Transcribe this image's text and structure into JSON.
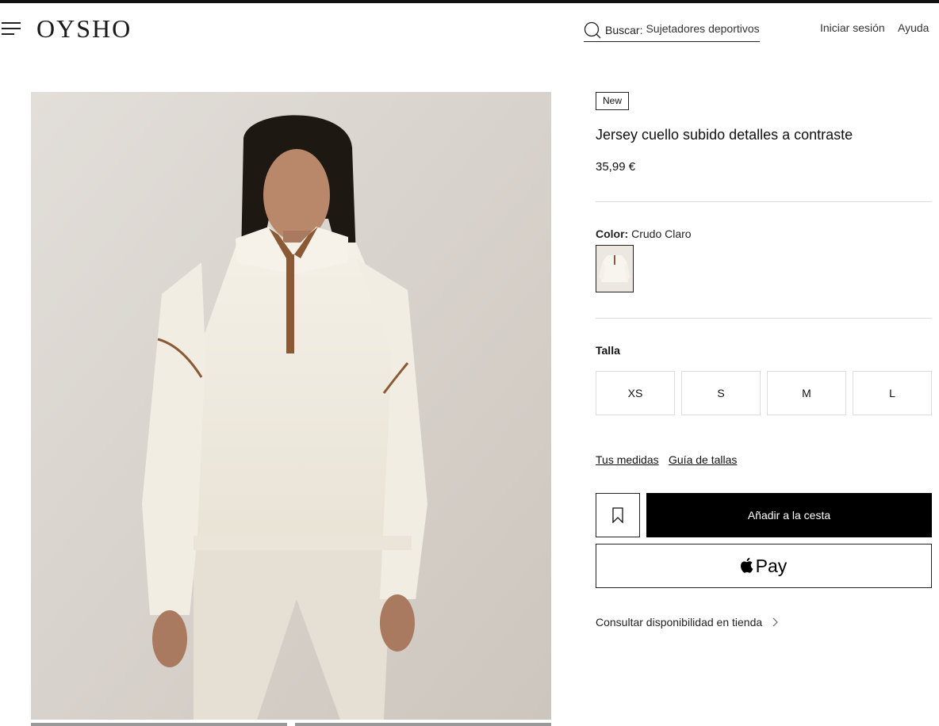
{
  "header": {
    "logo": "OYSHO",
    "search_label": "Buscar:",
    "search_query": "Sujetadores deportivos",
    "login": "Iniciar sesión",
    "help": "Ayuda"
  },
  "product": {
    "badge": "New",
    "title": "Jersey cuello subido detalles a contraste",
    "price": "35,99 €",
    "color_label": "Color:",
    "color_value": "Crudo Claro",
    "size_label": "Talla",
    "sizes": [
      "XS",
      "S",
      "M",
      "L"
    ],
    "links": {
      "measurements": "Tus medidas",
      "size_guide": "Guía de tallas"
    },
    "add_to_cart": "Añadir a la cesta",
    "apple_pay": "Pay",
    "store_availability": "Consultar disponibilidad en tienda"
  },
  "icons": {
    "menu": "hamburger-menu-icon",
    "search": "search-icon",
    "favorite": "bookmark-icon",
    "apple": "apple-logo-icon",
    "chevron": "chevron-right-icon"
  },
  "colors": {
    "accent": "#000000",
    "divider": "#dcdcdc",
    "background": "#ffffff"
  }
}
